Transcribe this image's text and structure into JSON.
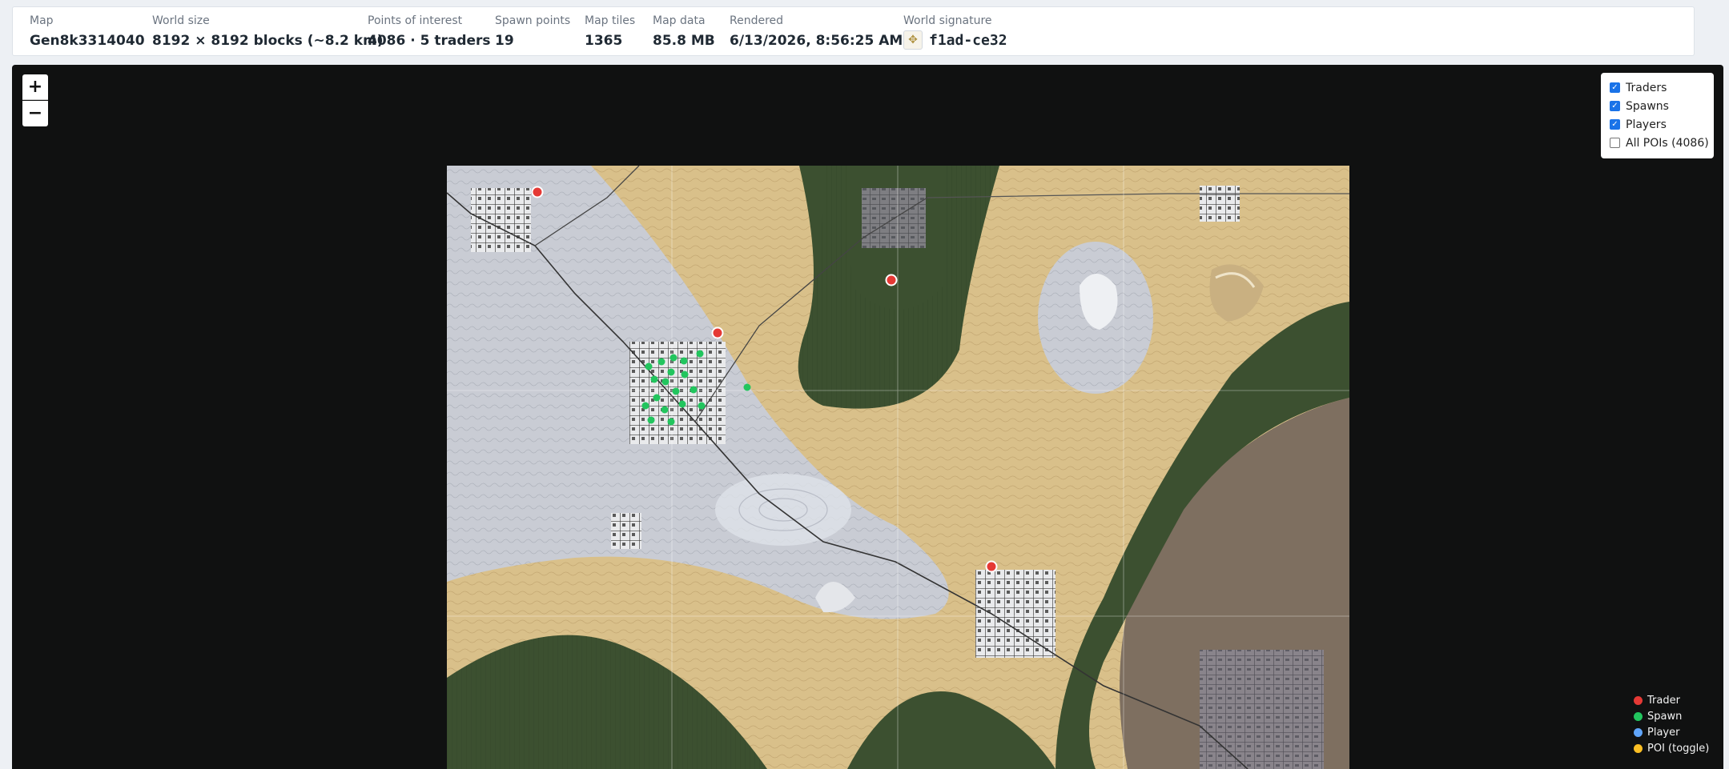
{
  "stats": [
    {
      "label": "Map",
      "value": "Gen8k3314040"
    },
    {
      "label": "World size",
      "value": "8192 × 8192 blocks (~8.2 km)"
    },
    {
      "label": "Points of interest",
      "value": "4086 · 5 traders"
    },
    {
      "label": "Spawn points",
      "value": "19"
    },
    {
      "label": "Map tiles",
      "value": "1365"
    },
    {
      "label": "Map data",
      "value": "85.8 MB"
    },
    {
      "label": "Rendered",
      "value": "6/13/2026, 8:56:25 AM"
    }
  ],
  "signature": {
    "label": "World signature",
    "value": "f1ad-ce32",
    "icon": "signature-glyph-icon"
  },
  "zoom": {
    "in": "+",
    "out": "−"
  },
  "layers": [
    {
      "label": "Traders",
      "checked": true
    },
    {
      "label": "Spawns",
      "checked": true
    },
    {
      "label": "Players",
      "checked": true
    },
    {
      "label": "All POIs (4086)",
      "checked": false
    }
  ],
  "legend": [
    {
      "label": "Trader",
      "color": "#e53935"
    },
    {
      "label": "Spawn",
      "color": "#22c55e"
    },
    {
      "label": "Player",
      "color": "#60a5fa"
    },
    {
      "label": "POI (toggle)",
      "color": "#fbbf24"
    }
  ],
  "colors": {
    "snow": "#c9ccd4",
    "desert": "#d9c08a",
    "forest": "#3c5030",
    "wasteland": "#7e6f60",
    "trader": "#e53935",
    "spawn": "#22c55e"
  }
}
